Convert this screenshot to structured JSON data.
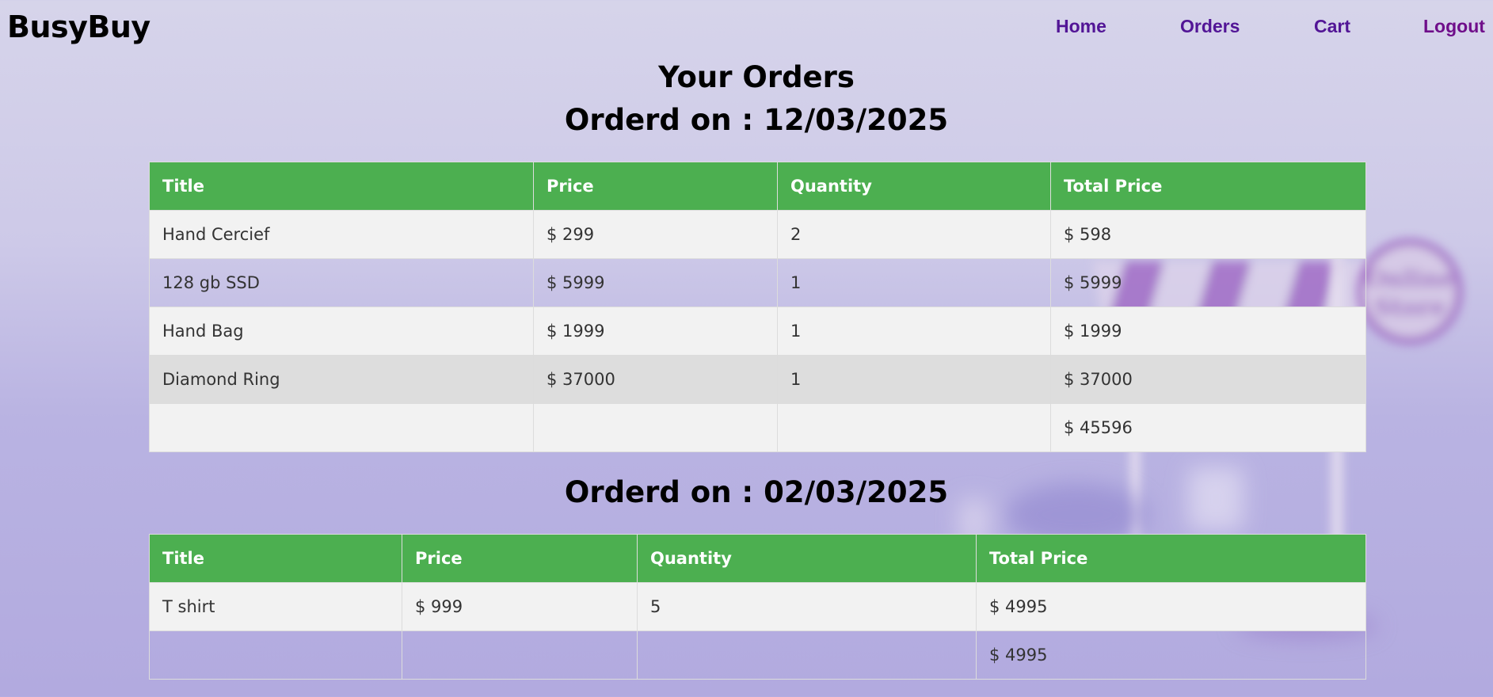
{
  "nav": {
    "brand": "BusyBuy",
    "links": [
      "Home",
      "Orders",
      "Cart",
      "Logout"
    ]
  },
  "page_title": "Your Orders",
  "orders": [
    {
      "date_label": "Orderd on : 12/03/2025",
      "headers": [
        "Title",
        "Price",
        "Quantity",
        "Total Price"
      ],
      "rows": [
        [
          "Hand Cercief",
          "$ 299",
          "2",
          "$ 598"
        ],
        [
          "128 gb SSD",
          "$ 5999",
          "1",
          "$ 5999"
        ],
        [
          "Hand Bag",
          "$ 1999",
          "1",
          "$ 1999"
        ],
        [
          "Diamond Ring",
          "$ 37000",
          "1",
          "$ 37000"
        ]
      ],
      "grand_total": "$ 45596"
    },
    {
      "date_label": "Orderd on : 02/03/2025",
      "headers": [
        "Title",
        "Price",
        "Quantity",
        "Total Price"
      ],
      "rows": [
        [
          "T shirt",
          "$ 999",
          "5",
          "$ 4995"
        ]
      ],
      "grand_total": "$ 4995"
    }
  ],
  "background": {
    "sign_text": "Online Store"
  },
  "colors": {
    "header_green": "#4caf50",
    "nav_link": "#521596",
    "logout_link": "#6f0e8a"
  }
}
